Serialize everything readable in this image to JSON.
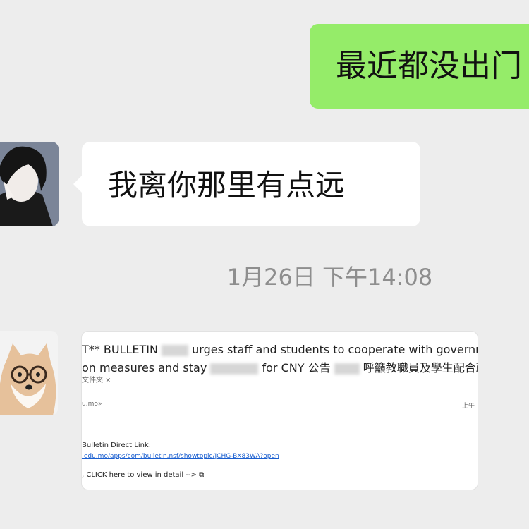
{
  "messages": {
    "outgoing_1": "最近都没出门",
    "incoming_1": "我离你那里有点远",
    "timestamp": "1月26日 下午14:08"
  },
  "email_card": {
    "subject_line_1_a": "T** BULLETIN",
    "subject_line_1_b": "urges staff and students to cooperate with government's e",
    "subject_line_2_a": "on measures and stay",
    "subject_line_2_b": "for CNY 公告",
    "subject_line_2_c": "呼籲教職員及學生配合政府防",
    "tag": "文件夾 ×",
    "sender": "u.mo»",
    "time": "上午",
    "link_label": "Bulletin Direct Link:",
    "link": ".edu.mo/apps/com/bulletin.nsf/showtopic/JCHG-BX83WA?open",
    "click_text": ", CLICK here to view in detail -->"
  },
  "colors": {
    "background": "#ededed",
    "outgoing_bubble": "#95ec69",
    "incoming_bubble": "#ffffff",
    "timestamp_text": "#8e8e8e",
    "link": "#1a5fd0"
  }
}
